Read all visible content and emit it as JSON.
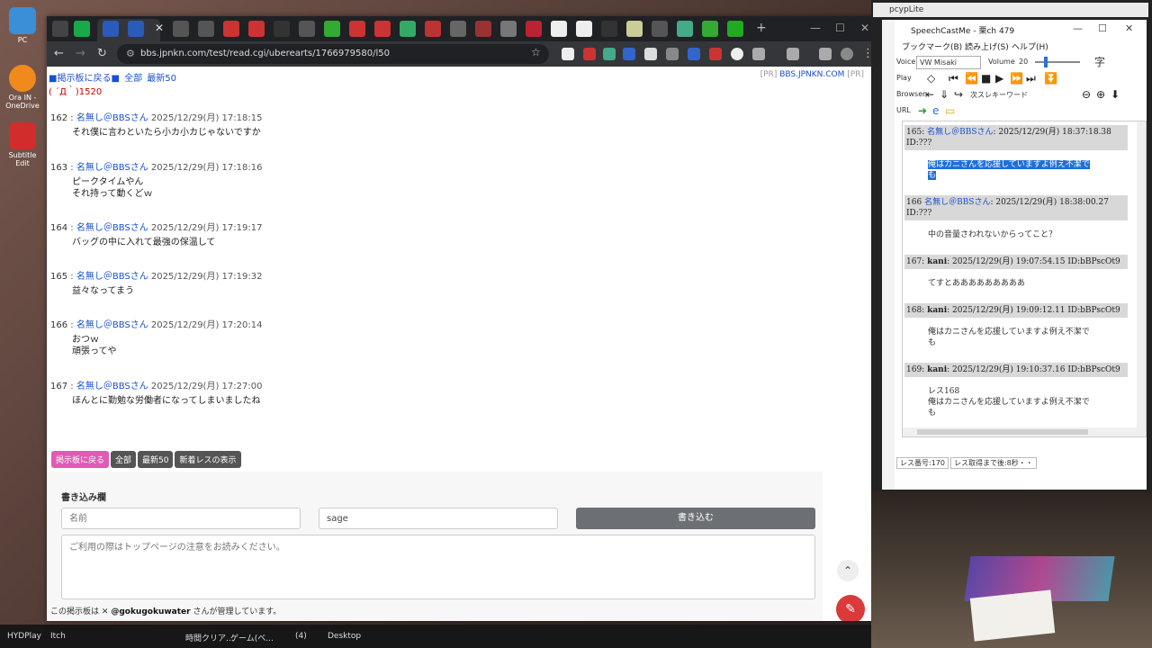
{
  "desktop": {
    "icons": [
      "PC",
      "Ora IN - OneDrive",
      "Subtitle Edit"
    ],
    "taskbar": [
      "HYDPlay",
      "Itch",
      "時間クリア...",
      "ゲーム(ベ...",
      "(4)",
      "Desktop"
    ]
  },
  "browser": {
    "url": "bbs.jpnkn.com/test/read.cgi/uberearts/1766979580/l50",
    "page": {
      "topnav": [
        "■掲示板に戻る■",
        "全部",
        "最新50"
      ],
      "pr_left": "[PR]",
      "pr_link": "BBS.JPNKN.COM",
      "pr_right": "[PR]",
      "face": "( ´Д｀)1520",
      "posts": [
        {
          "num": "162",
          "name": "名無し＠BBSさん",
          "date": "2025/12/29(月) 17:18:15",
          "lines": [
            "それ僕に言わといたら小カ小カじゃないですか"
          ]
        },
        {
          "num": "163",
          "name": "名無し＠BBSさん",
          "date": "2025/12/29(月) 17:18:16",
          "lines": [
            "ピークタイムやん",
            "それ持って動くどｗ"
          ]
        },
        {
          "num": "164",
          "name": "名無し＠BBSさん",
          "date": "2025/12/29(月) 17:19:17",
          "lines": [
            "バッグの中に入れて最強の保温して"
          ]
        },
        {
          "num": "165",
          "name": "名無し＠BBSさん",
          "date": "2025/12/29(月) 17:19:32",
          "lines": [
            "益々なってまう"
          ]
        },
        {
          "num": "166",
          "name": "名無し＠BBSさん",
          "date": "2025/12/29(月) 17:20:14",
          "lines": [
            "おつｗ",
            "頑張ってや"
          ]
        },
        {
          "num": "167",
          "name": "名無し＠BBSさん",
          "date": "2025/12/29(月) 17:27:00",
          "lines": [
            "ほんとに勤勉な労働者になってしまいましたね"
          ]
        }
      ],
      "buttons": [
        "掲示板に戻る",
        "全部",
        "最新50",
        "新着レスの表示"
      ],
      "form": {
        "title": "書き込み欄",
        "name_placeholder": "名前",
        "mail_value": "sage",
        "submit": "書き込む",
        "body_placeholder": "ご利用の際はトップページの注意をお読みください。"
      },
      "footer": {
        "prefix": "この掲示板は",
        "handle": "@gokugokuwater",
        "suffix": "さんが管理しています。"
      }
    }
  },
  "pcyp": {
    "title": "pcypLite"
  },
  "speechcast": {
    "title": "SpeechCastMe - 栗ch 479",
    "menu": [
      "ブックマーク(B)",
      "読み上げ(S)",
      "ヘルプ(H)"
    ],
    "voice_label": "Voice",
    "voice_value": "VW Misaki",
    "volume_label": "Volume",
    "volume_value": "20",
    "char_label": "字",
    "play_label": "Play",
    "browser_label": "Browser",
    "keyword_label": "次スレキーワード",
    "url_label": "URL",
    "items": [
      {
        "head_num": "165:",
        "name": "名無し＠BBSさん",
        "meta": ": 2025/12/29(月) 18:37:18.38 ID:???",
        "lines": [
          "俺はカニさんを応援していますよ例え不潔で",
          "も"
        ],
        "highlight": true
      },
      {
        "head_num": "166",
        "name": "名無し＠BBSさん",
        "meta": ": 2025/12/29(月) 18:38:00.27 ID:???",
        "lines": [
          "中の音量さわれないからってこと？"
        ],
        "highlight": false
      },
      {
        "head_num": "167:",
        "name": "kani",
        "meta": ": 2025/12/29(月) 19:07:54.15 ID:bBPscOt9",
        "lines": [
          "てすとあああああああああ"
        ],
        "highlight": false
      },
      {
        "head_num": "168:",
        "name": "kani",
        "meta": ": 2025/12/29(月) 19:09:12.11 ID:bBPscOt9",
        "lines": [
          "俺はカニさんを応援していますよ例え不潔で",
          "も"
        ],
        "highlight": false
      },
      {
        "head_num": "169:",
        "name": "kani",
        "meta": ": 2025/12/29(月) 19:10:37.16 ID:bBPscOt9",
        "lines": [
          "レス168",
          "俺はカニさんを応援していますよ例え不潔で",
          "も"
        ],
        "highlight": false
      }
    ],
    "status": [
      "レス番号:170",
      "レス取得まで後:8秒・・"
    ]
  }
}
